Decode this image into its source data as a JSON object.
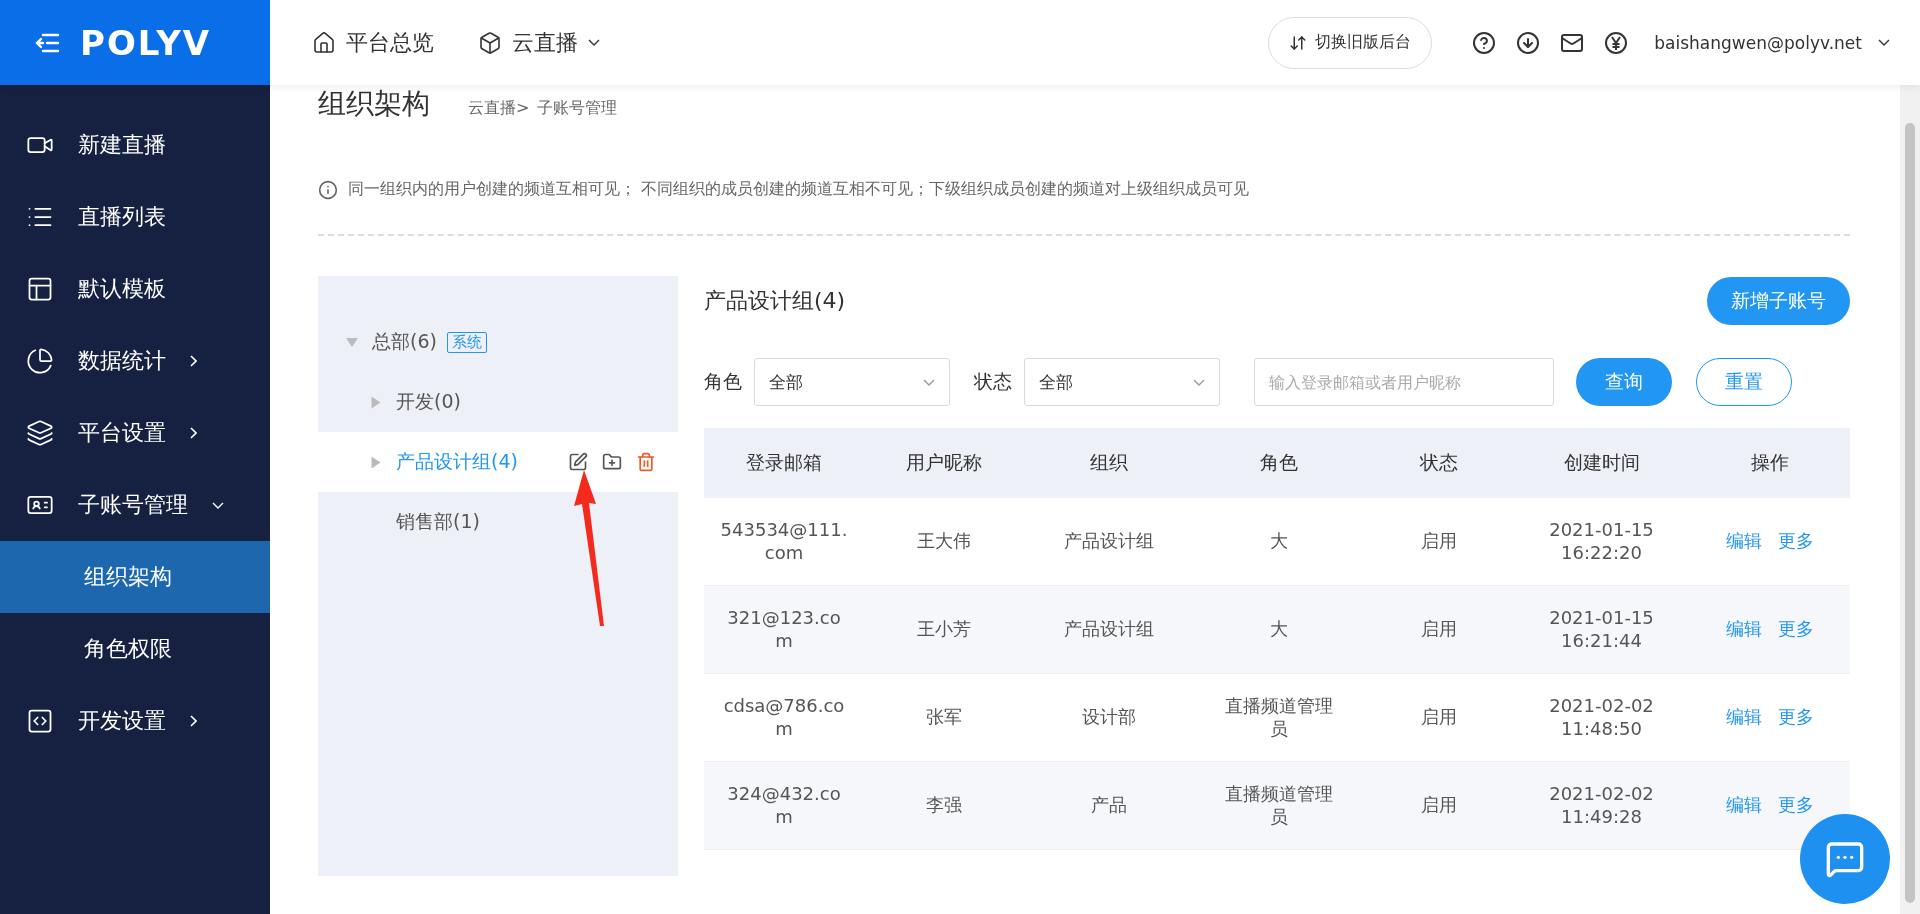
{
  "logo": {
    "text": "POLYV"
  },
  "top_nav": [
    {
      "label": "平台总览",
      "dropdown": false
    },
    {
      "label": "云直播",
      "dropdown": true
    }
  ],
  "switch_button": {
    "label": "切换旧版后台"
  },
  "account": {
    "email": "baishangwen@polyv.net"
  },
  "sidebar": {
    "items": [
      {
        "label": "新建直播",
        "selected": false
      },
      {
        "label": "直播列表",
        "selected": false
      },
      {
        "label": "默认模板",
        "selected": false
      },
      {
        "label": "数据统计",
        "selected": false,
        "expanded": false
      },
      {
        "label": "平台设置",
        "selected": false,
        "expanded": false
      },
      {
        "label": "子账号管理",
        "selected": false,
        "expanded": true,
        "children": [
          {
            "label": "组织架构",
            "selected": true
          },
          {
            "label": "角色权限",
            "selected": false
          }
        ]
      },
      {
        "label": "开发设置",
        "selected": false,
        "expanded": false
      }
    ]
  },
  "page": {
    "title": "组织架构",
    "breadcrumb": [
      "云直播>",
      "子账号管理"
    ],
    "notice": "同一组织内的用户创建的频道互相可见；  不同组织的成员创建的频道互相不可见；下级组织成员创建的频道对上级组织成员可见"
  },
  "tree": {
    "nodes": [
      {
        "label": "总部(6)",
        "tag": "系统",
        "kind": "branch",
        "expanded": true,
        "selected": false,
        "children": [
          {
            "label": "开发(0)",
            "kind": "branch",
            "expanded": false,
            "selected": false
          },
          {
            "label": "产品设计组(4)",
            "kind": "branch",
            "expanded": false,
            "selected": true
          },
          {
            "label": "销售部(1)",
            "kind": "leaf",
            "selected": false
          }
        ]
      }
    ]
  },
  "group": {
    "title": "产品设计组(4)",
    "add_button": "新增子账号",
    "filters": [
      {
        "label": "角色",
        "value": "全部"
      },
      {
        "label": "状态",
        "value": "全部"
      }
    ],
    "search": {
      "placeholder": "输入登录邮箱或者用户昵称"
    },
    "query_button": "查询",
    "reset_button": "重置"
  },
  "table": {
    "columns": [
      "登录邮箱",
      "用户昵称",
      "组织",
      "角色",
      "状态",
      "创建时间",
      "操作"
    ],
    "rows": [
      {
        "cells": [
          "543534@111.com",
          "王大伟",
          "产品设计组",
          "大",
          "启用",
          "2021-01-15 16:22:20"
        ],
        "actions": [
          "编辑",
          "更多"
        ]
      },
      {
        "cells": [
          "321@123.com",
          "王小芳",
          "产品设计组",
          "大",
          "启用",
          "2021-01-15 16:21:44"
        ],
        "actions": [
          "编辑",
          "更多"
        ]
      },
      {
        "cells": [
          "cdsa@786.com",
          "张军",
          "设计部",
          "直播频道管理员",
          "启用",
          "2021-02-02 11:48:50"
        ],
        "actions": [
          "编辑",
          "更多"
        ]
      },
      {
        "cells": [
          "324@432.com",
          "李强",
          "产品",
          "直播频道管理员",
          "启用",
          "2021-02-02 11:49:28"
        ],
        "actions": [
          "编辑",
          "更多"
        ]
      }
    ]
  }
}
